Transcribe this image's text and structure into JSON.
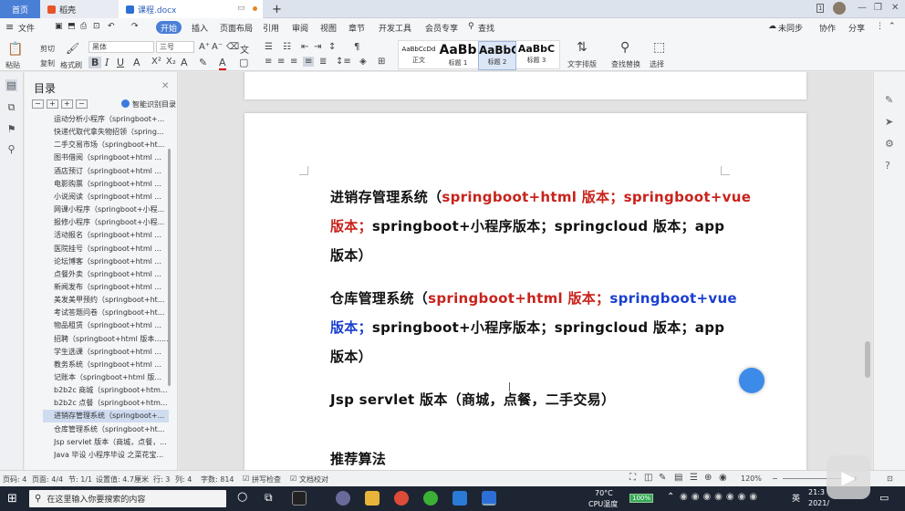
{
  "titlebar": {
    "tabs": [
      {
        "label": "首页"
      },
      {
        "label": "稻壳"
      },
      {
        "label": "课程.docx"
      }
    ],
    "add_tab": "+"
  },
  "ribbon": {
    "file_menu": "文件",
    "menus": [
      "开始",
      "插入",
      "页面布局",
      "引用",
      "审阅",
      "视图",
      "章节",
      "开发工具",
      "会员专享"
    ],
    "search_label": "查找",
    "right_links": [
      "未同步",
      "协作",
      "分享"
    ],
    "paste": "粘贴",
    "cut": "剪切",
    "copy": "复制",
    "format_painter": "格式刷",
    "font_name": "黑体",
    "font_size": "三号",
    "styles": [
      {
        "preview": "AaBbCcDd",
        "label": "正文"
      },
      {
        "preview": "AaBb",
        "label": "标题 1"
      },
      {
        "preview": "AaBbC",
        "label": "标题 2"
      },
      {
        "preview": "AaBbC",
        "label": "标题 3"
      }
    ],
    "text_layout": "文字排版",
    "find_replace": "查找替换",
    "select": "选择"
  },
  "outline": {
    "title": "目录",
    "smart_label": "智能识别目录",
    "items": [
      "运动分析小程序（springboot+...",
      "快递代取代拿失物招领（spring...",
      "二手交易市场（springboot+ht...",
      "图书借阅（springboot+html ...",
      "酒店预订（springboot+html ...",
      "电影购票（springboot+html ...",
      "小说阅读（springboot+html ...",
      "网课小程序（springboot+小程...",
      "报修小程序（springboot+小程...",
      "活动报名（springboot+html ...",
      "医院挂号（springboot+html ...",
      "论坛博客（springboot+html ...",
      "点餐外卖（springboot+html ...",
      "新闻发布（springboot+html ...",
      "美发美甲预约（springboot+ht...",
      "考试答题问卷（springboot+ht...",
      "物品租赁（springboot+html ...",
      "招聘（springboot+html 版本......",
      "学生选课（springboot+html ...",
      "教务系统（springboot+html ...",
      "记账本（springboot+html 版...",
      "b2b2c 商城（springboot+htm...",
      "b2b2c 点餐（springboot+htm...",
      "进销存管理系统（springboot+...",
      "仓库管理系统（springboot+ht...",
      "Jsp servlet 版本（商城，点餐，...",
      "Java 毕设 小程序毕设 之菜花宝..."
    ],
    "active_index": 23
  },
  "document": {
    "lines": [
      {
        "parts": [
          {
            "t": "进销存管理系统（",
            "c": ""
          },
          {
            "t": "springboot+html 版本；springboot+vue",
            "c": "red"
          }
        ]
      },
      {
        "parts": [
          {
            "t": "版本；",
            "c": "red"
          },
          {
            "t": "springboot+小程序版本；springcloud 版本；app",
            "c": ""
          }
        ]
      },
      {
        "parts": [
          {
            "t": "版本）",
            "c": ""
          }
        ]
      },
      {
        "parts": [
          {
            "t": "仓库管理系统（",
            "c": ""
          },
          {
            "t": "springboot+html 版本；",
            "c": "red"
          },
          {
            "t": "springboot+vue",
            "c": "blue"
          }
        ]
      },
      {
        "parts": [
          {
            "t": "版本；",
            "c": "blue"
          },
          {
            "t": "springboot+小程序版本；springcloud 版本；app",
            "c": ""
          }
        ]
      },
      {
        "parts": [
          {
            "t": "版本）",
            "c": ""
          }
        ]
      },
      {
        "parts": [
          {
            "t": "Jsp servlet 版本（商城，点餐，二手交易）",
            "c": ""
          }
        ]
      },
      {
        "parts": [
          {
            "t": "推荐算法",
            "c": ""
          }
        ]
      }
    ]
  },
  "statusbar": {
    "page": "页码: 4",
    "pages": "页面: 4/4",
    "section": "节: 1/1",
    "position": "设置值: 4.7厘米",
    "row": "行: 3",
    "col": "列: 4",
    "words": "字数: 814",
    "spell": "拼写检查",
    "proofread": "文档校对",
    "zoom": "120%"
  },
  "taskbar": {
    "search_placeholder": "在这里输入你要搜索的内容",
    "temperature": "70°C",
    "cpu": "CPU温度",
    "battery": "100%",
    "time": "21:3",
    "date": "2021/"
  },
  "colors": {
    "accent": "#4a7fd6",
    "red_text": "#c8231c",
    "blue_text": "#1a3fd0"
  }
}
